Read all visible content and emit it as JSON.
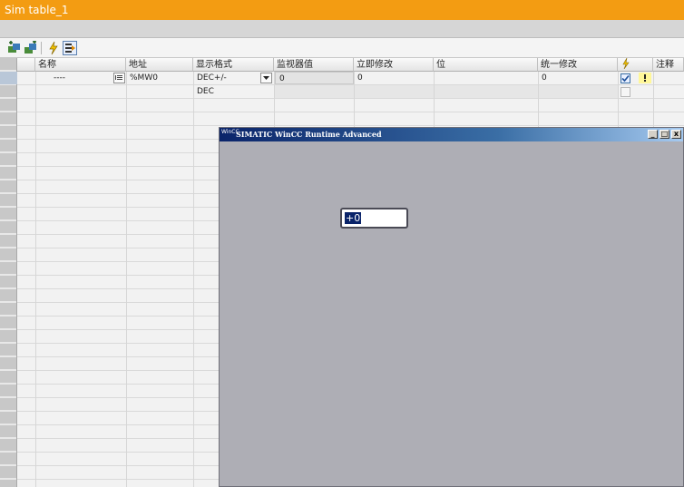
{
  "window": {
    "title": "Sim table_1"
  },
  "toolbar": {
    "buttons": [
      {
        "icon": "add-object-icon"
      },
      {
        "icon": "add-object-2-icon"
      },
      {
        "icon": "modify-lightning-icon"
      },
      {
        "icon": "monitor-all-icon",
        "active": true
      }
    ]
  },
  "table": {
    "columns": [
      "名称",
      "地址",
      "显示格式",
      "监视器值",
      "立即修改",
      "位",
      "统一修改",
      "",
      "注释"
    ],
    "rows": [
      {
        "name": "----",
        "address": "%MW0",
        "display_format": "DEC+/-",
        "monitor_value": "0",
        "modify_now": "0",
        "bit": "",
        "consistent_modify": "0",
        "checked": true
      },
      {
        "name": "",
        "address": "",
        "display_format": "DEC",
        "monitor_value": "",
        "modify_now": "",
        "bit": "",
        "consistent_modify": "",
        "checked": false
      }
    ]
  },
  "runtime": {
    "title": "SIMATIC WinCC Runtime Advanced",
    "logo_text": "WinCC",
    "io_value": "+0",
    "controls": [
      "_",
      "□",
      "x"
    ]
  },
  "colors": {
    "title_bar": "#f39c12",
    "runtime_bg": "#aeaeb5",
    "runtime_title": "#0a246a"
  }
}
